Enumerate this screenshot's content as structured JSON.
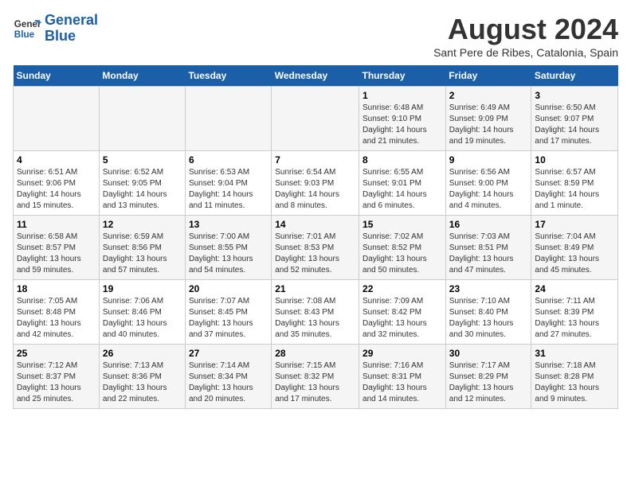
{
  "logo": {
    "line1": "General",
    "line2": "Blue"
  },
  "title": "August 2024",
  "subtitle": "Sant Pere de Ribes, Catalonia, Spain",
  "weekdays": [
    "Sunday",
    "Monday",
    "Tuesday",
    "Wednesday",
    "Thursday",
    "Friday",
    "Saturday"
  ],
  "weeks": [
    [
      {
        "day": "",
        "info": ""
      },
      {
        "day": "",
        "info": ""
      },
      {
        "day": "",
        "info": ""
      },
      {
        "day": "",
        "info": ""
      },
      {
        "day": "1",
        "info": "Sunrise: 6:48 AM\nSunset: 9:10 PM\nDaylight: 14 hours\nand 21 minutes."
      },
      {
        "day": "2",
        "info": "Sunrise: 6:49 AM\nSunset: 9:09 PM\nDaylight: 14 hours\nand 19 minutes."
      },
      {
        "day": "3",
        "info": "Sunrise: 6:50 AM\nSunset: 9:07 PM\nDaylight: 14 hours\nand 17 minutes."
      }
    ],
    [
      {
        "day": "4",
        "info": "Sunrise: 6:51 AM\nSunset: 9:06 PM\nDaylight: 14 hours\nand 15 minutes."
      },
      {
        "day": "5",
        "info": "Sunrise: 6:52 AM\nSunset: 9:05 PM\nDaylight: 14 hours\nand 13 minutes."
      },
      {
        "day": "6",
        "info": "Sunrise: 6:53 AM\nSunset: 9:04 PM\nDaylight: 14 hours\nand 11 minutes."
      },
      {
        "day": "7",
        "info": "Sunrise: 6:54 AM\nSunset: 9:03 PM\nDaylight: 14 hours\nand 8 minutes."
      },
      {
        "day": "8",
        "info": "Sunrise: 6:55 AM\nSunset: 9:01 PM\nDaylight: 14 hours\nand 6 minutes."
      },
      {
        "day": "9",
        "info": "Sunrise: 6:56 AM\nSunset: 9:00 PM\nDaylight: 14 hours\nand 4 minutes."
      },
      {
        "day": "10",
        "info": "Sunrise: 6:57 AM\nSunset: 8:59 PM\nDaylight: 14 hours\nand 1 minute."
      }
    ],
    [
      {
        "day": "11",
        "info": "Sunrise: 6:58 AM\nSunset: 8:57 PM\nDaylight: 13 hours\nand 59 minutes."
      },
      {
        "day": "12",
        "info": "Sunrise: 6:59 AM\nSunset: 8:56 PM\nDaylight: 13 hours\nand 57 minutes."
      },
      {
        "day": "13",
        "info": "Sunrise: 7:00 AM\nSunset: 8:55 PM\nDaylight: 13 hours\nand 54 minutes."
      },
      {
        "day": "14",
        "info": "Sunrise: 7:01 AM\nSunset: 8:53 PM\nDaylight: 13 hours\nand 52 minutes."
      },
      {
        "day": "15",
        "info": "Sunrise: 7:02 AM\nSunset: 8:52 PM\nDaylight: 13 hours\nand 50 minutes."
      },
      {
        "day": "16",
        "info": "Sunrise: 7:03 AM\nSunset: 8:51 PM\nDaylight: 13 hours\nand 47 minutes."
      },
      {
        "day": "17",
        "info": "Sunrise: 7:04 AM\nSunset: 8:49 PM\nDaylight: 13 hours\nand 45 minutes."
      }
    ],
    [
      {
        "day": "18",
        "info": "Sunrise: 7:05 AM\nSunset: 8:48 PM\nDaylight: 13 hours\nand 42 minutes."
      },
      {
        "day": "19",
        "info": "Sunrise: 7:06 AM\nSunset: 8:46 PM\nDaylight: 13 hours\nand 40 minutes."
      },
      {
        "day": "20",
        "info": "Sunrise: 7:07 AM\nSunset: 8:45 PM\nDaylight: 13 hours\nand 37 minutes."
      },
      {
        "day": "21",
        "info": "Sunrise: 7:08 AM\nSunset: 8:43 PM\nDaylight: 13 hours\nand 35 minutes."
      },
      {
        "day": "22",
        "info": "Sunrise: 7:09 AM\nSunset: 8:42 PM\nDaylight: 13 hours\nand 32 minutes."
      },
      {
        "day": "23",
        "info": "Sunrise: 7:10 AM\nSunset: 8:40 PM\nDaylight: 13 hours\nand 30 minutes."
      },
      {
        "day": "24",
        "info": "Sunrise: 7:11 AM\nSunset: 8:39 PM\nDaylight: 13 hours\nand 27 minutes."
      }
    ],
    [
      {
        "day": "25",
        "info": "Sunrise: 7:12 AM\nSunset: 8:37 PM\nDaylight: 13 hours\nand 25 minutes."
      },
      {
        "day": "26",
        "info": "Sunrise: 7:13 AM\nSunset: 8:36 PM\nDaylight: 13 hours\nand 22 minutes."
      },
      {
        "day": "27",
        "info": "Sunrise: 7:14 AM\nSunset: 8:34 PM\nDaylight: 13 hours\nand 20 minutes."
      },
      {
        "day": "28",
        "info": "Sunrise: 7:15 AM\nSunset: 8:32 PM\nDaylight: 13 hours\nand 17 minutes."
      },
      {
        "day": "29",
        "info": "Sunrise: 7:16 AM\nSunset: 8:31 PM\nDaylight: 13 hours\nand 14 minutes."
      },
      {
        "day": "30",
        "info": "Sunrise: 7:17 AM\nSunset: 8:29 PM\nDaylight: 13 hours\nand 12 minutes."
      },
      {
        "day": "31",
        "info": "Sunrise: 7:18 AM\nSunset: 8:28 PM\nDaylight: 13 hours\nand 9 minutes."
      }
    ]
  ]
}
